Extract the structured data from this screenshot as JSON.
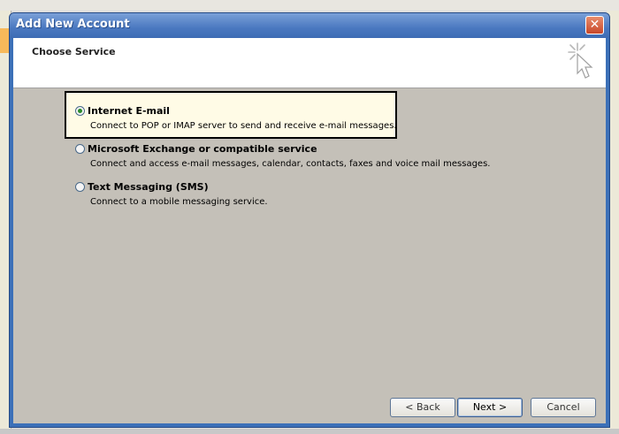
{
  "window": {
    "title": "Add New Account",
    "close_glyph": "✕"
  },
  "header": {
    "section_title": "Choose Service",
    "icon": "wizard-cursor-icon"
  },
  "options": [
    {
      "label": "Internet E-mail",
      "description": "Connect to POP or IMAP server to send and receive e-mail messages.",
      "selected": true
    },
    {
      "label": "Microsoft Exchange or compatible service",
      "description": "Connect and access e-mail messages, calendar, contacts, faxes and voice mail messages.",
      "selected": false
    },
    {
      "label": "Text Messaging (SMS)",
      "description": "Connect to a mobile messaging service.",
      "selected": false
    }
  ],
  "buttons": {
    "back": "< Back",
    "next": "Next >",
    "cancel": "Cancel"
  },
  "colors": {
    "titlebar": "#4a78c0",
    "selected_highlight": "#fffbe6",
    "radio_dot": "#2a8a2a"
  }
}
